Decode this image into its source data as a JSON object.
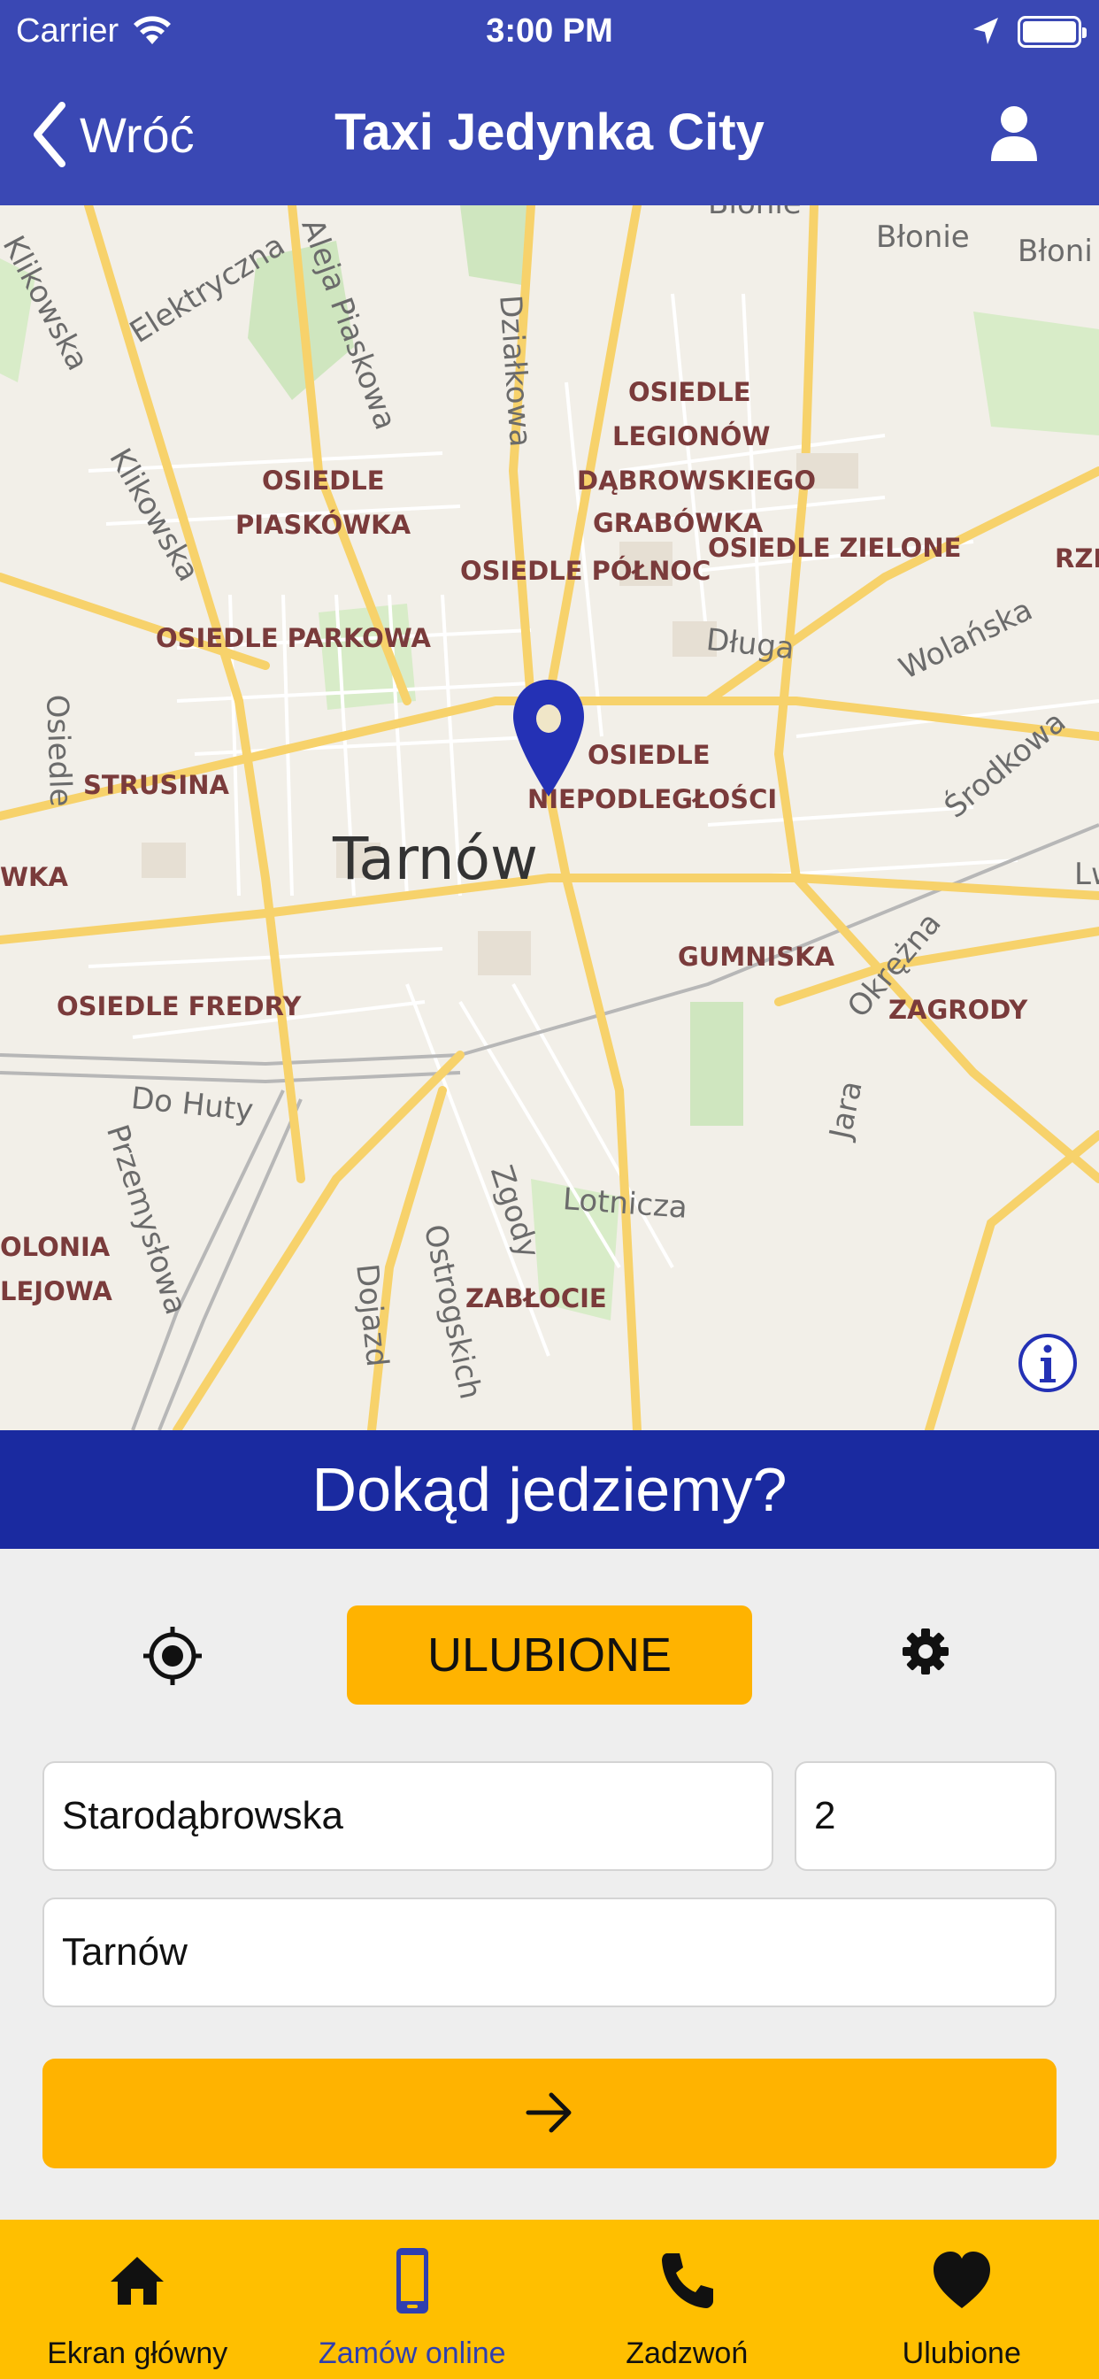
{
  "status_bar": {
    "carrier": "Carrier",
    "time": "3:00 PM"
  },
  "nav": {
    "back_label": "Wróć",
    "title": "Taxi Jedynka City"
  },
  "map": {
    "city": "Tarnów",
    "districts": [
      "OSIEDLE",
      "LEGIONÓW",
      "DĄBROWSKIEGO",
      "GRABÓWKA",
      "OSIEDLE ZIELONE",
      "OSIEDLE",
      "PIASKÓWKA",
      "OSIEDLE PÓŁNOC",
      "OSIEDLE PARKOWA",
      "STRUSINA",
      "OSIEDLE",
      "NIEPODLEGŁOŚCI",
      "GUMNISKA",
      "ZAGRODY",
      "OSIEDLE FREDRY",
      "ZABŁOCIE",
      "OLONIA",
      "LEJOWA",
      "RZĘ",
      "WKA"
    ],
    "streets": [
      "Klikowska",
      "Elektryczna",
      "Aleja Piaskowa",
      "Działkowa",
      "Błonie",
      "Błonie",
      "Błoni",
      "Klikowska",
      "Długa",
      "Wolańska",
      "Środkowa",
      "Osiedle",
      "Okrężna",
      "Lw",
      "Do Huty",
      "Przemysłowa",
      "Jara",
      "Lotnicza",
      "Zgody",
      "Ostrogskich",
      "Dojazd"
    ]
  },
  "banner": {
    "question": "Dokąd jedziemy?"
  },
  "form": {
    "favorites_label": "ULUBIONE",
    "street_value": "Starodąbrowska",
    "number_value": "2",
    "city_value": "Tarnów"
  },
  "tabs": [
    {
      "label": "Ekran główny"
    },
    {
      "label": "Zamów online"
    },
    {
      "label": "Zadzwoń"
    },
    {
      "label": "Ulubione"
    }
  ],
  "colors": {
    "header": "#3a48b4",
    "banner": "#1a2aa0",
    "accent": "#ffb300",
    "tabbar": "#ffbf00",
    "active_tab": "#2f3fb0"
  }
}
